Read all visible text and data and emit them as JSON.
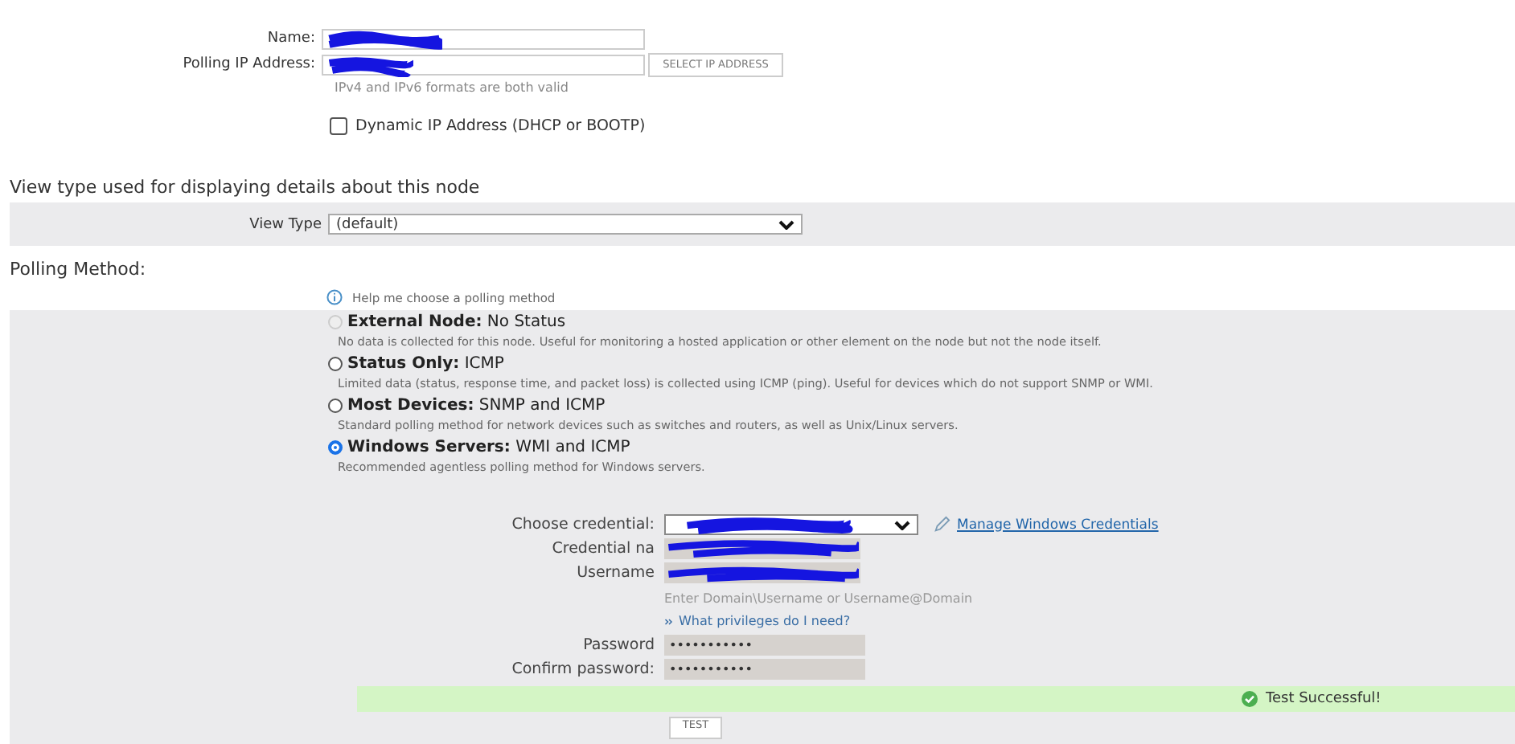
{
  "node": {
    "name_label": "Name:",
    "ip_label": "Polling IP Address:",
    "select_ip_button": "SELECT IP ADDRESS",
    "ip_hint": "IPv4 and IPv6 formats are both valid",
    "dynamic_ip": {
      "label": "Dynamic IP Address (DHCP or BOOTP)",
      "checked": false
    }
  },
  "view_section": {
    "title": "View type used for displaying details about this node",
    "label": "View Type",
    "value": "(default)"
  },
  "polling": {
    "title": "Polling Method:",
    "help_link": "Help me choose a polling method",
    "methods": [
      {
        "name": "External Node:",
        "detail": "No Status",
        "description": "No data is collected for this node. Useful for monitoring a hosted application or other element on the node but not the node itself.",
        "selected": false,
        "disabled": true
      },
      {
        "name": "Status Only:",
        "detail": "ICMP",
        "description": "Limited data (status, response time, and packet loss) is collected using ICMP (ping). Useful for devices which do not support SNMP or WMI.",
        "selected": false,
        "disabled": false
      },
      {
        "name": "Most Devices:",
        "detail": "SNMP and ICMP",
        "description": "Standard polling method for network devices such as switches and routers, as well as Unix/Linux servers.",
        "selected": false,
        "disabled": false
      },
      {
        "name": "Windows Servers:",
        "detail": "WMI and ICMP",
        "description": "Recommended agentless polling method for Windows servers.",
        "selected": true,
        "disabled": false
      }
    ]
  },
  "credentials": {
    "choose_label": "Choose credential:",
    "manage_link": "Manage Windows Credentials",
    "name_label": "Credential na",
    "username_label": "Username",
    "username_hint": "Enter Domain\\Username or Username@Domain",
    "privileges_link": "What privileges do I need?",
    "password_label": "Password",
    "password_value": "•••••••••••",
    "confirm_label": "Confirm password:",
    "confirm_value": "•••••••••••",
    "test_result": "Test Successful!",
    "test_button": "TEST"
  }
}
